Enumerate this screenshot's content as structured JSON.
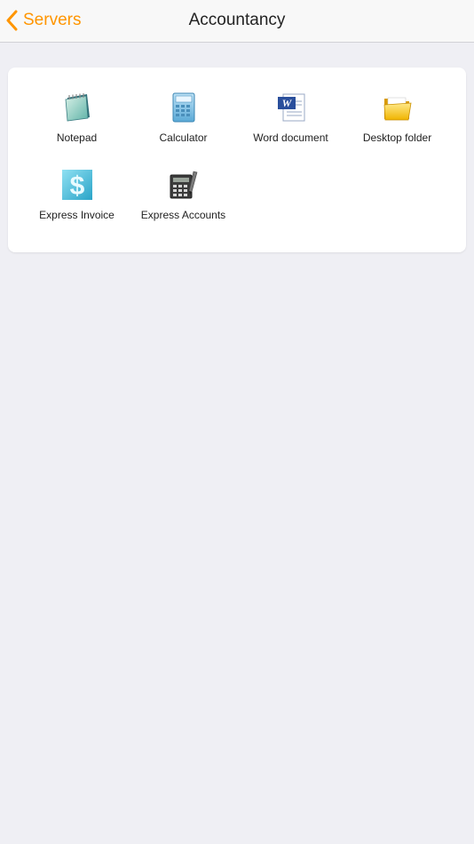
{
  "navbar": {
    "back_label": "Servers",
    "title": "Accountancy",
    "accent_color": "#ff9500"
  },
  "apps": [
    {
      "label": "Notepad",
      "icon": "notepad-icon"
    },
    {
      "label": "Calculator",
      "icon": "calculator-icon"
    },
    {
      "label": "Word document",
      "icon": "word-document-icon"
    },
    {
      "label": "Desktop folder",
      "icon": "folder-icon"
    },
    {
      "label": "Express Invoice",
      "icon": "invoice-dollar-icon"
    },
    {
      "label": "Express Accounts",
      "icon": "accounts-calculator-icon"
    }
  ]
}
